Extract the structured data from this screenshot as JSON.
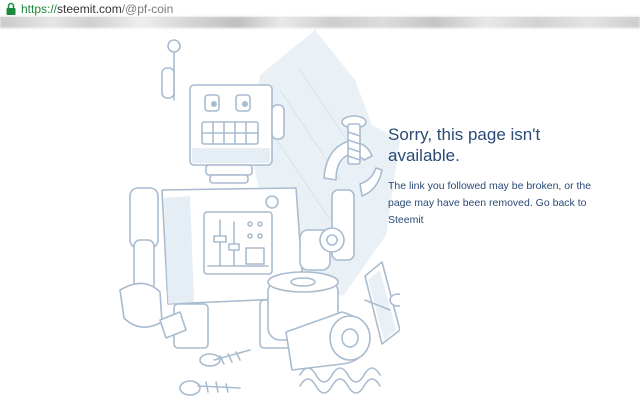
{
  "browser": {
    "url_scheme": "https://",
    "url_domain": "steemit.com",
    "url_path": "/@pf-coin"
  },
  "error": {
    "title": "Sorry, this page isn't available.",
    "message": "The link you followed may be broken, or the page may have been removed. Go back to",
    "link_label": "Steemit"
  },
  "colors": {
    "text": "#2b4a76",
    "illustration_line": "#a9bccf",
    "illustration_shade": "#dfe9f2",
    "url_secure": "#1b8a3a"
  },
  "icons": [
    "lock-icon",
    "robot-illustration"
  ]
}
